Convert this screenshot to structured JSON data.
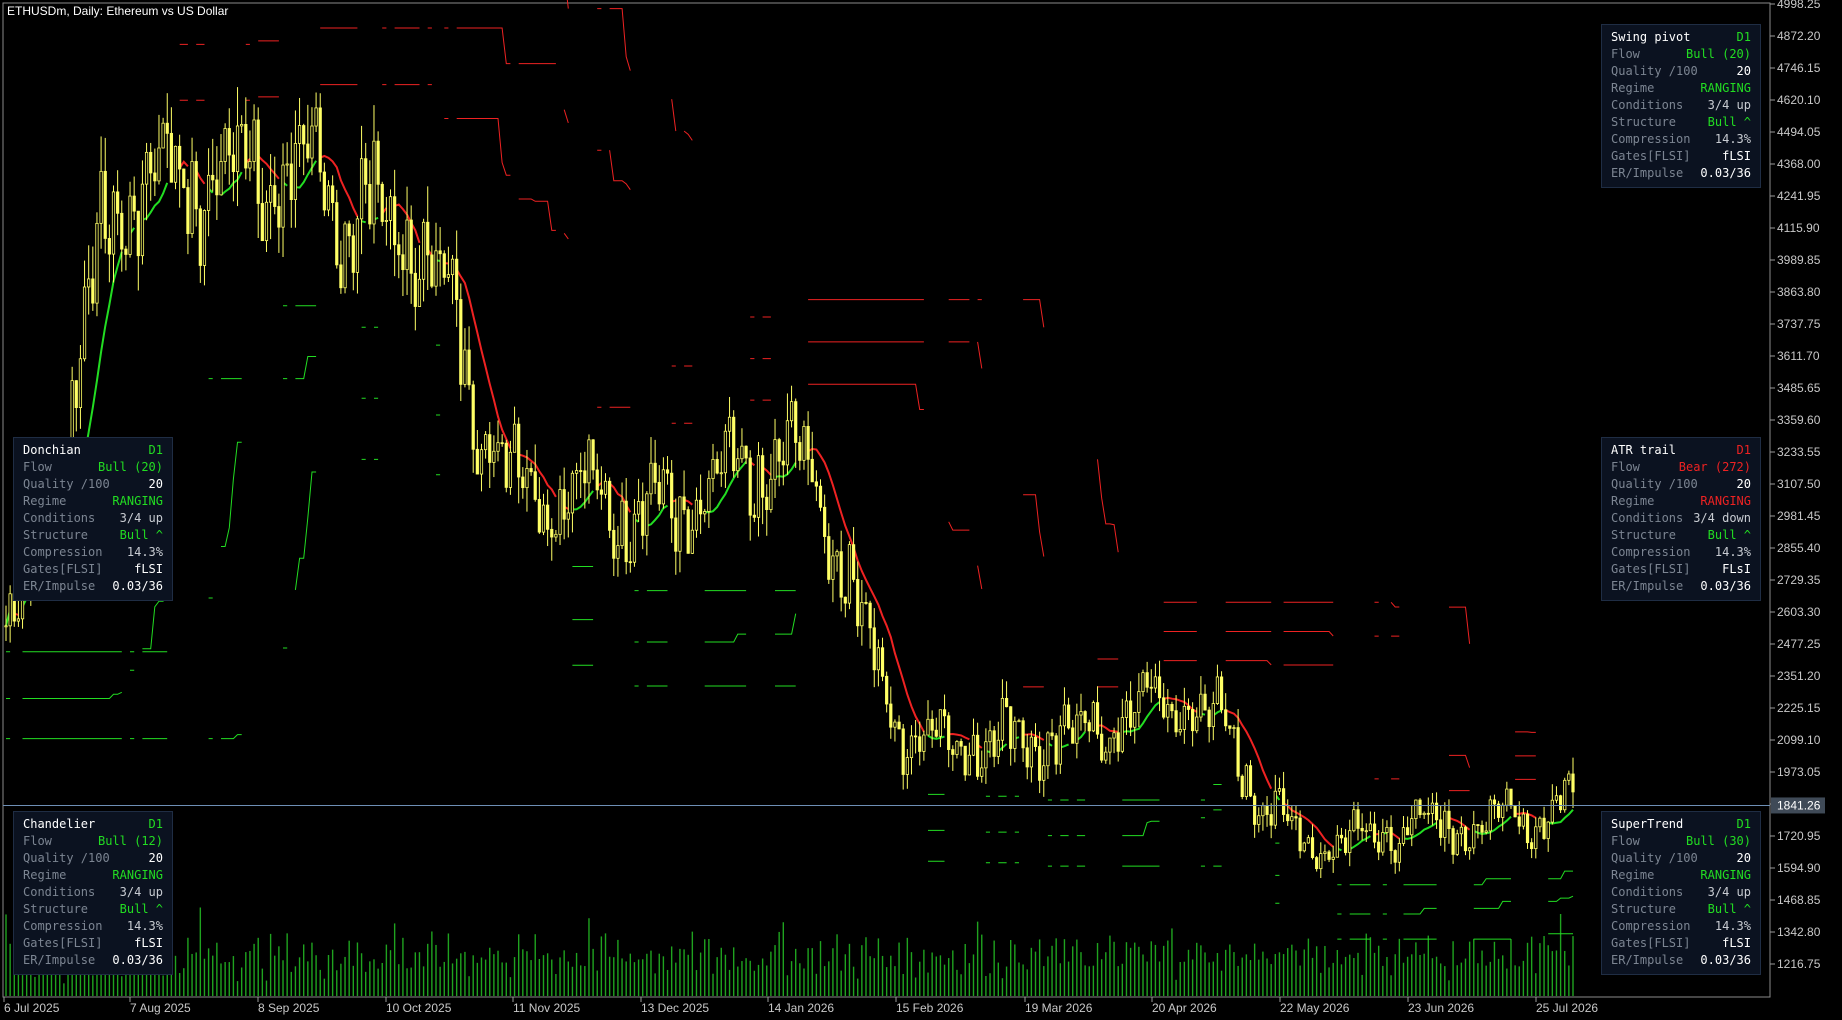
{
  "title": "ETHUSDm, Daily:  Ethereum vs US Dollar",
  "price_axis": [
    "4998.25",
    "4872.20",
    "4746.15",
    "4620.10",
    "4494.05",
    "4368.00",
    "4241.95",
    "4115.90",
    "3989.85",
    "3863.80",
    "3737.75",
    "3611.70",
    "3485.65",
    "3359.60",
    "3233.55",
    "3107.50",
    "2981.45",
    "2855.40",
    "2729.35",
    "2603.30",
    "2477.25",
    "2351.20",
    "2225.15",
    "2099.10",
    "1973.05",
    "1847.00",
    "1720.95",
    "1594.90",
    "1468.85",
    "1342.80",
    "1216.75"
  ],
  "current_price": "1841.26",
  "dates": [
    "6 Jul 2025",
    "7 Aug 2025",
    "8 Sep 2025",
    "10 Oct 2025",
    "11 Nov 2025",
    "13 Dec 2025",
    "14 Jan 2026",
    "15 Feb 2026",
    "19 Mar 2026",
    "20 Apr 2026",
    "22 May 2026",
    "23 Jun 2026",
    "25 Jul 2026"
  ],
  "colors": {
    "candle": "#ffff66",
    "bull": "#22dd22",
    "bear": "#ee2222",
    "volume": "#1fa31f",
    "grid": "#303030"
  },
  "panels": [
    {
      "name": "Donchian",
      "tf": "D1",
      "tf_color": "green",
      "rows": [
        {
          "label": "Flow",
          "value": "Bull (20)",
          "color": "green"
        },
        {
          "label": "Quality /100",
          "value": "20",
          "color": "white"
        },
        {
          "label": "Regime",
          "value": "RANGING",
          "color": "green"
        },
        {
          "label": "Conditions",
          "value": "3/4 up",
          "color": "gray"
        },
        {
          "label": "Structure",
          "value": "Bull ^",
          "color": "green"
        },
        {
          "label": "Compression",
          "value": "14.3%",
          "color": "gray"
        },
        {
          "label": "Gates[FLSI]",
          "value": "fLSI",
          "color": "white"
        },
        {
          "label": "ER/Impulse",
          "value": "0.03/36",
          "color": "white"
        }
      ]
    },
    {
      "name": "Chandelier",
      "tf": "D1",
      "tf_color": "green",
      "rows": [
        {
          "label": "Flow",
          "value": "Bull (12)",
          "color": "green"
        },
        {
          "label": "Quality /100",
          "value": "20",
          "color": "white"
        },
        {
          "label": "Regime",
          "value": "RANGING",
          "color": "green"
        },
        {
          "label": "Conditions",
          "value": "3/4 up",
          "color": "gray"
        },
        {
          "label": "Structure",
          "value": "Bull ^",
          "color": "green"
        },
        {
          "label": "Compression",
          "value": "14.3%",
          "color": "gray"
        },
        {
          "label": "Gates[FLSI]",
          "value": "fLSI",
          "color": "white"
        },
        {
          "label": "ER/Impulse",
          "value": "0.03/36",
          "color": "white"
        }
      ]
    },
    {
      "name": "Swing pivot",
      "tf": "D1",
      "tf_color": "green",
      "rows": [
        {
          "label": "Flow",
          "value": "Bull (20)",
          "color": "green"
        },
        {
          "label": "Quality /100",
          "value": "20",
          "color": "white"
        },
        {
          "label": "Regime",
          "value": "RANGING",
          "color": "green"
        },
        {
          "label": "Conditions",
          "value": "3/4 up",
          "color": "gray"
        },
        {
          "label": "Structure",
          "value": "Bull ^",
          "color": "green"
        },
        {
          "label": "Compression",
          "value": "14.3%",
          "color": "gray"
        },
        {
          "label": "Gates[FLSI]",
          "value": "fLSI",
          "color": "white"
        },
        {
          "label": "ER/Impulse",
          "value": "0.03/36",
          "color": "white"
        }
      ]
    },
    {
      "name": "ATR trail",
      "tf": "D1",
      "tf_color": "red",
      "rows": [
        {
          "label": "Flow",
          "value": "Bear (272)",
          "color": "red"
        },
        {
          "label": "Quality /100",
          "value": "20",
          "color": "white"
        },
        {
          "label": "Regime",
          "value": "RANGING",
          "color": "red"
        },
        {
          "label": "Conditions",
          "value": "3/4 down",
          "color": "gray"
        },
        {
          "label": "Structure",
          "value": "Bull ^",
          "color": "green"
        },
        {
          "label": "Compression",
          "value": "14.3%",
          "color": "gray"
        },
        {
          "label": "Gates[FLSI]",
          "value": "FLsI",
          "color": "white"
        },
        {
          "label": "ER/Impulse",
          "value": "0.03/36",
          "color": "white"
        }
      ]
    },
    {
      "name": "SuperTrend",
      "tf": "D1",
      "tf_color": "green",
      "rows": [
        {
          "label": "Flow",
          "value": "Bull (30)",
          "color": "green"
        },
        {
          "label": "Quality /100",
          "value": "20",
          "color": "white"
        },
        {
          "label": "Regime",
          "value": "RANGING",
          "color": "green"
        },
        {
          "label": "Conditions",
          "value": "3/4 up",
          "color": "gray"
        },
        {
          "label": "Structure",
          "value": "Bull ^",
          "color": "green"
        },
        {
          "label": "Compression",
          "value": "14.3%",
          "color": "gray"
        },
        {
          "label": "Gates[FLSI]",
          "value": "fLSI",
          "color": "white"
        },
        {
          "label": "ER/Impulse",
          "value": "0.03/36",
          "color": "white"
        }
      ]
    }
  ],
  "chart_data": {
    "type": "line",
    "title": "ETHUSDm, Daily:  Ethereum vs US Dollar",
    "x": [
      "6 Jul 2025",
      "7 Aug 2025",
      "8 Sep 2025",
      "10 Oct 2025",
      "11 Nov 2025",
      "13 Dec 2025",
      "14 Jan 2026",
      "15 Feb 2026",
      "19 Mar 2026",
      "20 Apr 2026",
      "22 May 2026",
      "23 Jun 2026",
      "25 Jul 2026"
    ],
    "ylim": [
      1150,
      5010
    ],
    "series": [
      {
        "values": [
          2550,
          4300,
          4350,
          4120,
          3100,
          3000,
          3200,
          2100,
          2100,
          2250,
          1700,
          1760,
          1841
        ]
      }
    ]
  }
}
